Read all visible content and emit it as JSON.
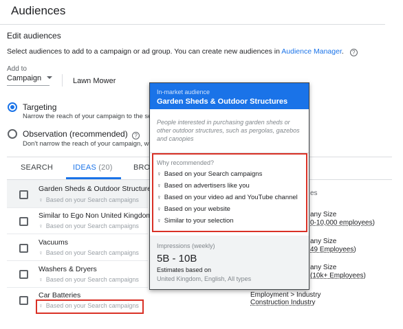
{
  "header": {
    "title": "Audiences"
  },
  "edit": {
    "heading": "Edit audiences",
    "instructions_prefix": "Select audiences to add to a campaign or ad group. You can create new audiences in ",
    "instructions_link": "Audience Manager",
    "instructions_suffix": ".",
    "help_icon": "question-circle-icon"
  },
  "add_to": {
    "label": "Add to",
    "selected": "Campaign",
    "campaign_name": "Lawn Mower"
  },
  "options": [
    {
      "title": "Targeting",
      "desc": "Narrow the reach of your campaign to the sele",
      "selected": true
    },
    {
      "title": "Observation (recommended)",
      "desc": "Don't narrow the reach of your campaign, with",
      "selected": false
    }
  ],
  "tabs": [
    {
      "label": "SEARCH",
      "count": ""
    },
    {
      "label": "IDEAS",
      "count": "(20)"
    },
    {
      "label": "BRO",
      "count": ""
    }
  ],
  "ideas": [
    {
      "name": "Garden Sheds & Outdoor Structures",
      "sub": "Based on your Search campaigns"
    },
    {
      "name": "Similar to Ego Non United Kingdom T",
      "sub": "Based on your Search campaigns"
    },
    {
      "name": "Vacuums",
      "sub": "Based on your Search campaigns"
    },
    {
      "name": "Washers & Dryers",
      "sub": "Based on your Search campaigns"
    },
    {
      "name": "Car Batteries",
      "sub": "Based on your Search campaigns"
    }
  ],
  "right_col": {
    "header": "es",
    "rows": [
      {
        "line1": "any Size",
        "line2": "0-10,000 employees)"
      },
      {
        "line1": "any Size",
        "line2": "49 Employees)"
      },
      {
        "line1": "any Size",
        "line2": "(10k+ Employees)"
      },
      {
        "line1": "Employment > Industry",
        "line2": "Construction Industry"
      }
    ]
  },
  "popup": {
    "kicker": "In-market audience",
    "title": "Garden Sheds & Outdoor Structures",
    "description": "People interested in purchasing garden sheds or other outdoor structures, such as pergolas, gazebos and canopies",
    "why_title": "Why recommended?",
    "reasons": [
      "Based on your Search campaigns",
      "Based on advertisers like you",
      "Based on your video ad and YouTube channel",
      "Based on your website",
      "Similar to your selection"
    ],
    "impressions_label": "Impressions (weekly)",
    "impressions_value": "5B - 10B",
    "estimates_label": "Estimates based on",
    "estimates_scope": "United Kingdom, English, All types"
  },
  "colors": {
    "accent": "#1a73e8",
    "highlight": "#d93025"
  }
}
